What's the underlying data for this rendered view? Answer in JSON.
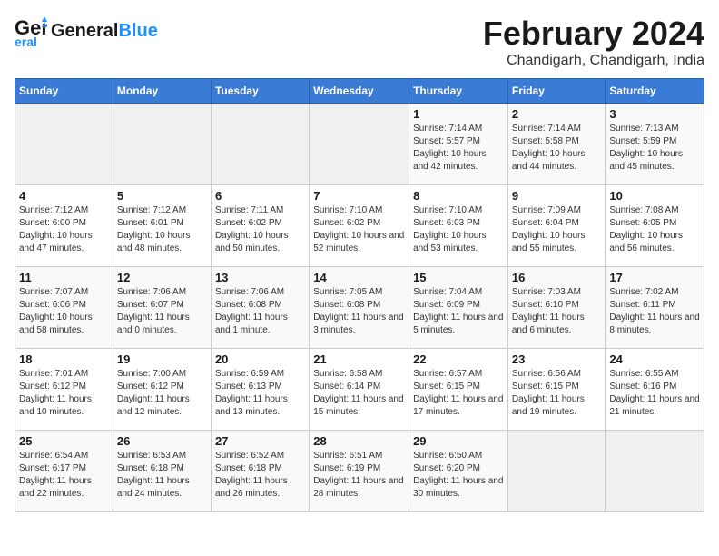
{
  "header": {
    "logo_general": "General",
    "logo_blue": "Blue",
    "month_title": "February 2024",
    "location": "Chandigarh, Chandigarh, India"
  },
  "weekdays": [
    "Sunday",
    "Monday",
    "Tuesday",
    "Wednesday",
    "Thursday",
    "Friday",
    "Saturday"
  ],
  "weeks": [
    [
      {
        "day": "",
        "empty": true
      },
      {
        "day": "",
        "empty": true
      },
      {
        "day": "",
        "empty": true
      },
      {
        "day": "",
        "empty": true
      },
      {
        "day": "1",
        "sunrise": "7:14 AM",
        "sunset": "5:57 PM",
        "daylight": "10 hours and 42 minutes."
      },
      {
        "day": "2",
        "sunrise": "7:14 AM",
        "sunset": "5:58 PM",
        "daylight": "10 hours and 44 minutes."
      },
      {
        "day": "3",
        "sunrise": "7:13 AM",
        "sunset": "5:59 PM",
        "daylight": "10 hours and 45 minutes."
      }
    ],
    [
      {
        "day": "4",
        "sunrise": "7:12 AM",
        "sunset": "6:00 PM",
        "daylight": "10 hours and 47 minutes."
      },
      {
        "day": "5",
        "sunrise": "7:12 AM",
        "sunset": "6:01 PM",
        "daylight": "10 hours and 48 minutes."
      },
      {
        "day": "6",
        "sunrise": "7:11 AM",
        "sunset": "6:02 PM",
        "daylight": "10 hours and 50 minutes."
      },
      {
        "day": "7",
        "sunrise": "7:10 AM",
        "sunset": "6:02 PM",
        "daylight": "10 hours and 52 minutes."
      },
      {
        "day": "8",
        "sunrise": "7:10 AM",
        "sunset": "6:03 PM",
        "daylight": "10 hours and 53 minutes."
      },
      {
        "day": "9",
        "sunrise": "7:09 AM",
        "sunset": "6:04 PM",
        "daylight": "10 hours and 55 minutes."
      },
      {
        "day": "10",
        "sunrise": "7:08 AM",
        "sunset": "6:05 PM",
        "daylight": "10 hours and 56 minutes."
      }
    ],
    [
      {
        "day": "11",
        "sunrise": "7:07 AM",
        "sunset": "6:06 PM",
        "daylight": "10 hours and 58 minutes."
      },
      {
        "day": "12",
        "sunrise": "7:06 AM",
        "sunset": "6:07 PM",
        "daylight": "11 hours and 0 minutes."
      },
      {
        "day": "13",
        "sunrise": "7:06 AM",
        "sunset": "6:08 PM",
        "daylight": "11 hours and 1 minute."
      },
      {
        "day": "14",
        "sunrise": "7:05 AM",
        "sunset": "6:08 PM",
        "daylight": "11 hours and 3 minutes."
      },
      {
        "day": "15",
        "sunrise": "7:04 AM",
        "sunset": "6:09 PM",
        "daylight": "11 hours and 5 minutes."
      },
      {
        "day": "16",
        "sunrise": "7:03 AM",
        "sunset": "6:10 PM",
        "daylight": "11 hours and 6 minutes."
      },
      {
        "day": "17",
        "sunrise": "7:02 AM",
        "sunset": "6:11 PM",
        "daylight": "11 hours and 8 minutes."
      }
    ],
    [
      {
        "day": "18",
        "sunrise": "7:01 AM",
        "sunset": "6:12 PM",
        "daylight": "11 hours and 10 minutes."
      },
      {
        "day": "19",
        "sunrise": "7:00 AM",
        "sunset": "6:12 PM",
        "daylight": "11 hours and 12 minutes."
      },
      {
        "day": "20",
        "sunrise": "6:59 AM",
        "sunset": "6:13 PM",
        "daylight": "11 hours and 13 minutes."
      },
      {
        "day": "21",
        "sunrise": "6:58 AM",
        "sunset": "6:14 PM",
        "daylight": "11 hours and 15 minutes."
      },
      {
        "day": "22",
        "sunrise": "6:57 AM",
        "sunset": "6:15 PM",
        "daylight": "11 hours and 17 minutes."
      },
      {
        "day": "23",
        "sunrise": "6:56 AM",
        "sunset": "6:15 PM",
        "daylight": "11 hours and 19 minutes."
      },
      {
        "day": "24",
        "sunrise": "6:55 AM",
        "sunset": "6:16 PM",
        "daylight": "11 hours and 21 minutes."
      }
    ],
    [
      {
        "day": "25",
        "sunrise": "6:54 AM",
        "sunset": "6:17 PM",
        "daylight": "11 hours and 22 minutes."
      },
      {
        "day": "26",
        "sunrise": "6:53 AM",
        "sunset": "6:18 PM",
        "daylight": "11 hours and 24 minutes."
      },
      {
        "day": "27",
        "sunrise": "6:52 AM",
        "sunset": "6:18 PM",
        "daylight": "11 hours and 26 minutes."
      },
      {
        "day": "28",
        "sunrise": "6:51 AM",
        "sunset": "6:19 PM",
        "daylight": "11 hours and 28 minutes."
      },
      {
        "day": "29",
        "sunrise": "6:50 AM",
        "sunset": "6:20 PM",
        "daylight": "11 hours and 30 minutes."
      },
      {
        "day": "",
        "empty": true
      },
      {
        "day": "",
        "empty": true
      }
    ]
  ]
}
